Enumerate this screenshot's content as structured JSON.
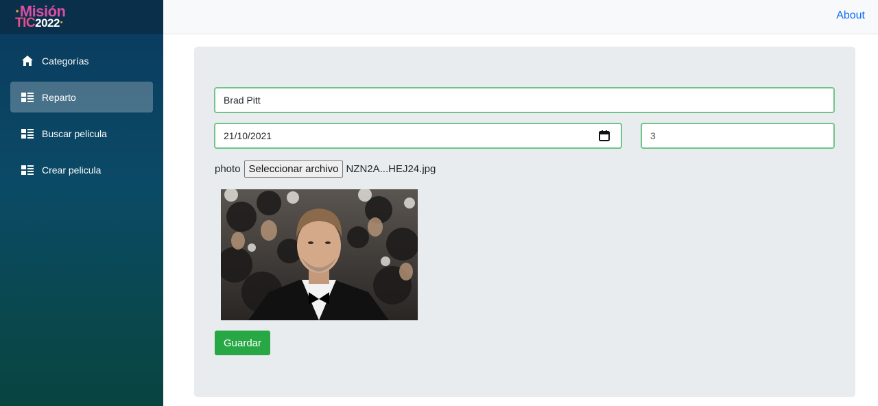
{
  "brand": {
    "logo_line1": "Misión",
    "logo_line2_a": "TIC",
    "logo_line2_b": "2022"
  },
  "sidebar": {
    "items": [
      {
        "label": "Categorías",
        "icon": "home-icon",
        "active": false
      },
      {
        "label": "Reparto",
        "icon": "list-icon",
        "active": true
      },
      {
        "label": "Buscar pelicula",
        "icon": "list-icon",
        "active": false
      },
      {
        "label": "Crear pelicula",
        "icon": "list-icon",
        "active": false
      }
    ]
  },
  "topbar": {
    "about_label": "About"
  },
  "form": {
    "name_value": "Brad Pitt",
    "date_value": "21/10/2021",
    "number_value": "3",
    "file_label": "photo",
    "file_button_label": "Seleccionar archivo",
    "file_name": "NZN2A...HEJ24.jpg",
    "save_label": "Guardar"
  },
  "colors": {
    "accent_green": "#28a745",
    "input_border": "#6ec586",
    "link_blue": "#0d6efd"
  }
}
